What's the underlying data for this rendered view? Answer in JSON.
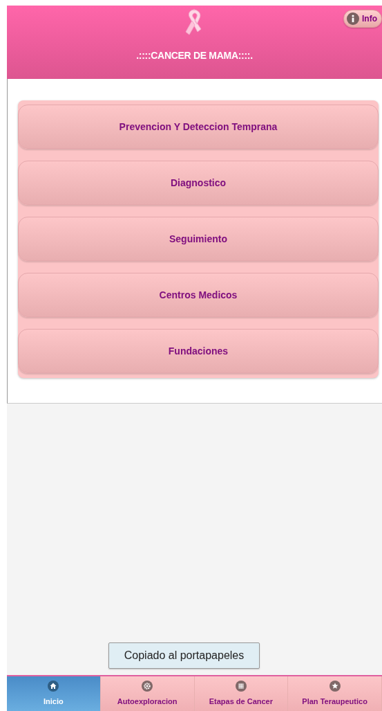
{
  "header": {
    "title": ".::::CANCER DE MAMA::::.",
    "info_button": "Info"
  },
  "menu": [
    {
      "label": "Prevencion Y Deteccion Temprana"
    },
    {
      "label": "Diagnostico"
    },
    {
      "label": "Seguimiento"
    },
    {
      "label": "Centros Medicos"
    },
    {
      "label": "Fundaciones"
    }
  ],
  "toast": "Copiado al portapapeles",
  "tabs": [
    {
      "label": "Inicio",
      "selected": true
    },
    {
      "label": "Autoexploracion",
      "selected": false
    },
    {
      "label": "Etapas de Cancer",
      "selected": false
    },
    {
      "label": "Plan Teraupeutico",
      "selected": false
    }
  ]
}
